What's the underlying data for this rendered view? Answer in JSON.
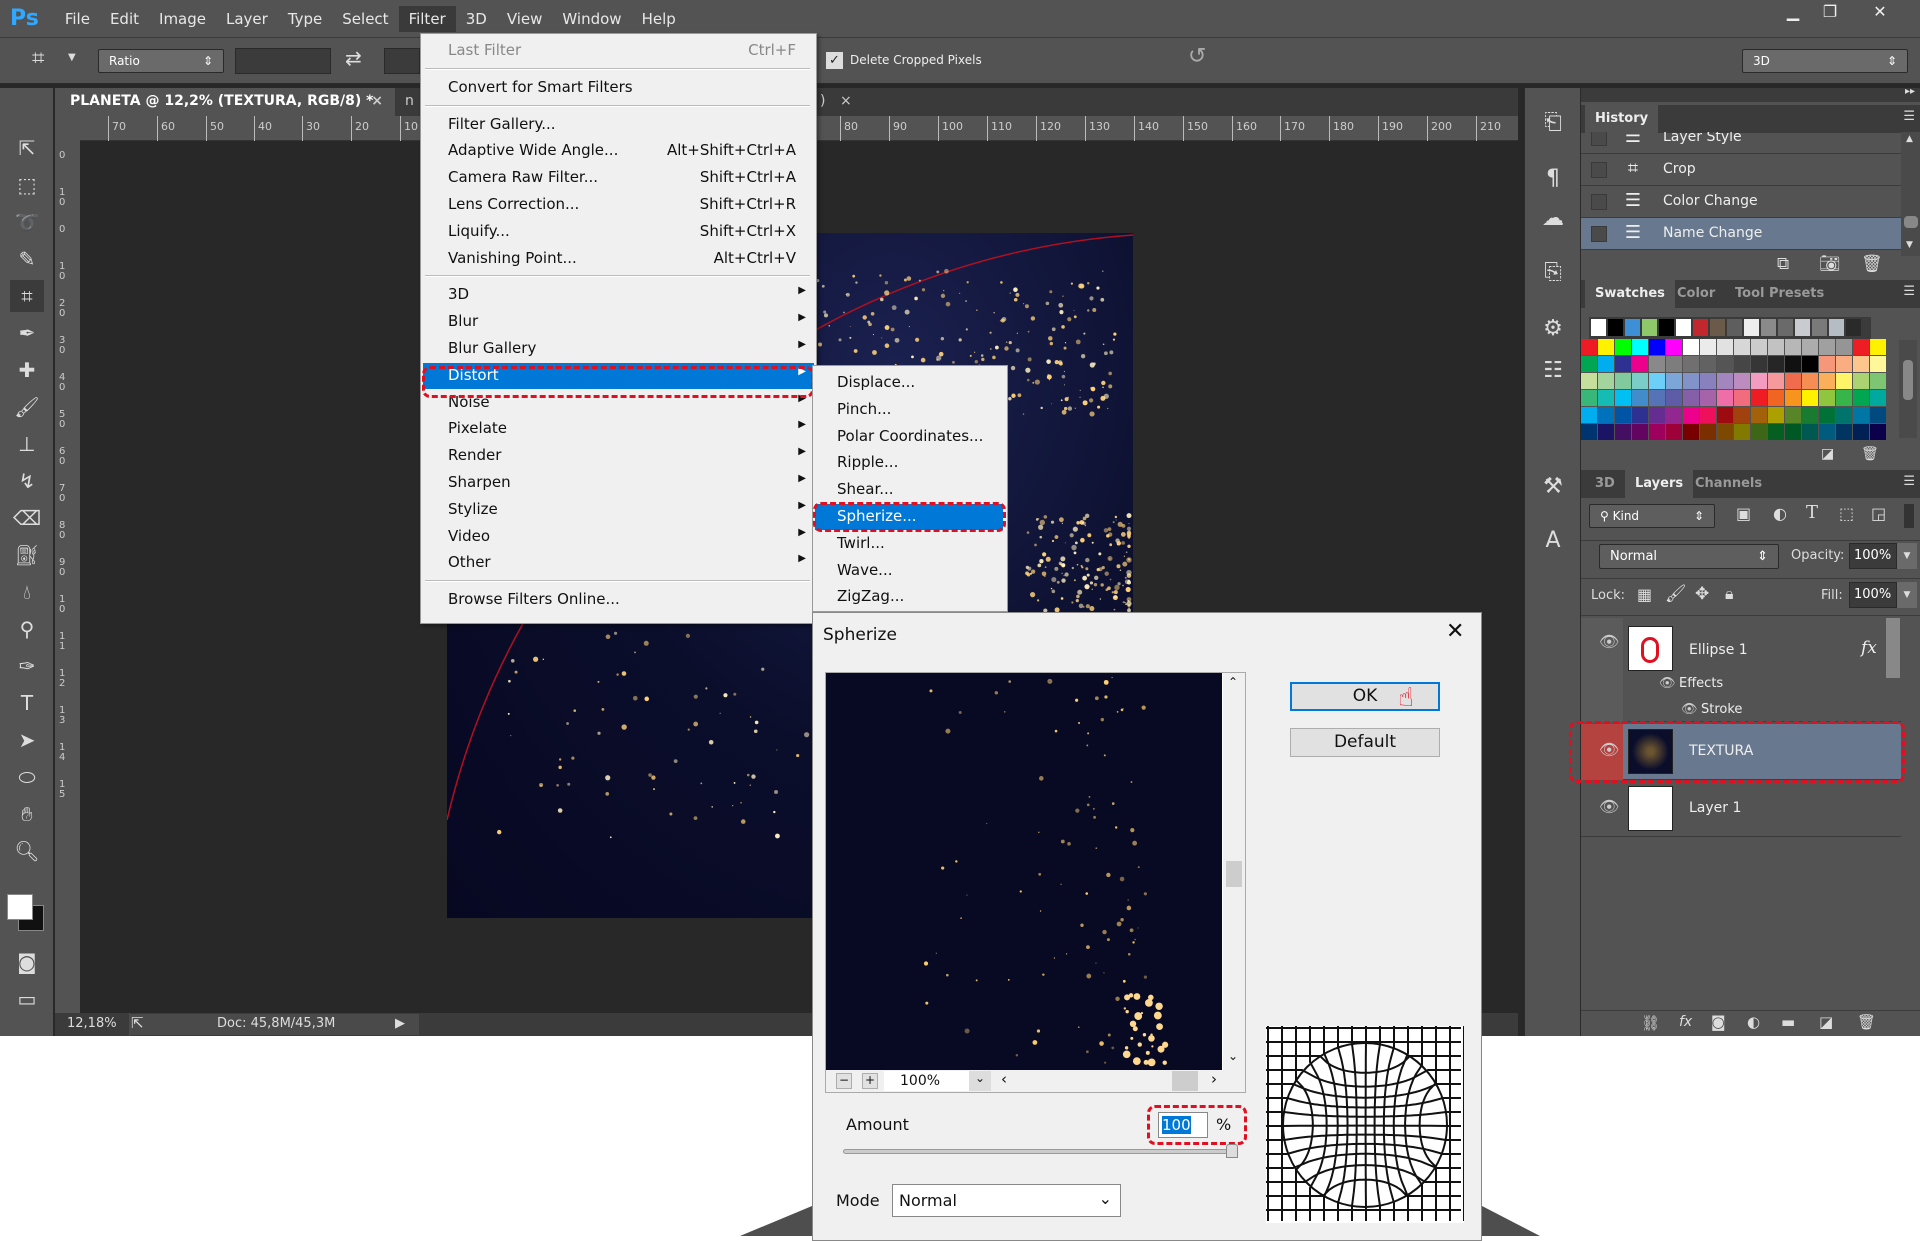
{
  "app": {
    "logo": "Ps",
    "menu": [
      "File",
      "Edit",
      "Image",
      "Layer",
      "Type",
      "Select",
      "Filter",
      "3D",
      "View",
      "Window",
      "Help"
    ],
    "active_menu": "Filter",
    "window_controls": [
      "minimize",
      "restore",
      "close"
    ]
  },
  "options": {
    "ratio": "Ratio",
    "delete_cropped": "Delete Cropped Pixels",
    "delete_cropped_checked": true,
    "workspace": "3D"
  },
  "document": {
    "tab_title": "PLANETA @ 12,2% (TEXTURA, RGB/8) *",
    "tab2_partial": "n",
    "tab2_close_partial": ")",
    "ruler_h": [
      "70",
      "60",
      "50",
      "40",
      "30",
      "20",
      "10",
      "80",
      "90",
      "100",
      "110",
      "120",
      "130",
      "140",
      "150",
      "160",
      "170",
      "180",
      "190",
      "200",
      "210"
    ],
    "ruler_v": [
      "0",
      "1 0",
      "0",
      "1 0",
      "2 0",
      "3 0",
      "4 0",
      "5 0",
      "6 0",
      "7 0",
      "8 0",
      "9 0",
      "1 0",
      "1 1",
      "1 2",
      "1 3",
      "1 4",
      "1 5"
    ],
    "zoom": "12,18%",
    "doc_size": "Doc: 45,8M/45,3M"
  },
  "filter_menu": {
    "items": [
      {
        "label": "Last Filter",
        "shortcut": "Ctrl+F",
        "disabled": true
      },
      {
        "sep": true
      },
      {
        "label": "Convert for Smart Filters"
      },
      {
        "sep": true
      },
      {
        "label": "Filter Gallery..."
      },
      {
        "label": "Adaptive Wide Angle...",
        "shortcut": "Alt+Shift+Ctrl+A"
      },
      {
        "label": "Camera Raw Filter...",
        "shortcut": "Shift+Ctrl+A"
      },
      {
        "label": "Lens Correction...",
        "shortcut": "Shift+Ctrl+R"
      },
      {
        "label": "Liquify...",
        "shortcut": "Shift+Ctrl+X"
      },
      {
        "label": "Vanishing Point...",
        "shortcut": "Alt+Ctrl+V"
      },
      {
        "sep": true
      },
      {
        "label": "3D",
        "sub": true
      },
      {
        "label": "Blur",
        "sub": true
      },
      {
        "label": "Blur Gallery",
        "sub": true
      },
      {
        "label": "Distort",
        "sub": true,
        "highlight": true
      },
      {
        "label": "Noise",
        "sub": true
      },
      {
        "label": "Pixelate",
        "sub": true
      },
      {
        "label": "Render",
        "sub": true
      },
      {
        "label": "Sharpen",
        "sub": true
      },
      {
        "label": "Stylize",
        "sub": true
      },
      {
        "label": "Video",
        "sub": true
      },
      {
        "label": "Other",
        "sub": true
      },
      {
        "sep": true
      },
      {
        "label": "Browse Filters Online..."
      }
    ]
  },
  "distort_submenu": {
    "items": [
      "Displace...",
      "Pinch...",
      "Polar Coordinates...",
      "Ripple...",
      "Shear...",
      "Spherize...",
      "Twirl...",
      "Wave...",
      "ZigZag..."
    ],
    "highlight": "Spherize..."
  },
  "dialog": {
    "title": "Spherize",
    "ok": "OK",
    "default": "Default",
    "preview_zoom": "100%",
    "amount_label": "Amount",
    "amount": "100",
    "amount_unit": "%",
    "amount_value": 100,
    "mode_label": "Mode",
    "mode": "Normal"
  },
  "history": {
    "tab": "History",
    "items": [
      {
        "label": "Layer Style",
        "icon": "document-icon"
      },
      {
        "label": "Crop",
        "icon": "crop-icon"
      },
      {
        "label": "Color Change",
        "icon": "document-icon"
      },
      {
        "label": "Name Change",
        "icon": "document-icon",
        "selected": true
      }
    ]
  },
  "swatches": {
    "tabs": [
      "Swatches",
      "Color",
      "Tool Presets"
    ],
    "recent": [
      "#ffffff",
      "#000000",
      "#3d8fd6",
      "#8fc86a",
      "#000000",
      "#ffffff",
      "#c1272d",
      "#6b5a4a",
      "#5e5e5e",
      "#eeeeee",
      "#8a8a8a",
      "#6a6a6a",
      "#c8ccd0",
      "#7a7a7a",
      "#b5bcc4",
      "#2a2a2a"
    ],
    "grid": [
      [
        "#ed1c24",
        "#fff200",
        "#00ff00",
        "#00ffff",
        "#0000ff",
        "#ff00ff",
        "#ffffff",
        "#ebebeb",
        "#e1e1e1",
        "#d7d7d7",
        "#cccccc",
        "#c2c2c2",
        "#b7b7b7",
        "#acacac",
        "#a0a0a0",
        "#959595",
        "#ee1d24",
        "#fff100"
      ],
      [
        "#00a651",
        "#00aeef",
        "#2e3192",
        "#ec008c",
        "#898989",
        "#7d7d7d",
        "#707070",
        "#626262",
        "#555555",
        "#464646",
        "#363636",
        "#262626",
        "#111111",
        "#000000",
        "#f7977a",
        "#fbad82",
        "#fdc68c",
        "#fff799"
      ],
      [
        "#c6df9c",
        "#a4d49d",
        "#81ca9d",
        "#7bcdc9",
        "#6ccff7",
        "#7ca6d8",
        "#8293ca",
        "#8881be",
        "#a286bd",
        "#bc8cbf",
        "#f49bc1",
        "#f5999d",
        "#f16c4d",
        "#f68e54",
        "#fbaf5a",
        "#fff467",
        "#acd372",
        "#7dc473"
      ],
      [
        "#39b778",
        "#16bcb4",
        "#00bff3",
        "#438ccb",
        "#5573b7",
        "#5e5ca7",
        "#855fa8",
        "#a763a9",
        "#ef6ea8",
        "#f16d7e",
        "#ee1d24",
        "#f16522",
        "#f7941d",
        "#fff100",
        "#8fc63d",
        "#37b44a",
        "#00a650",
        "#00a99e"
      ],
      [
        "#00aeef",
        "#0072bc",
        "#0054a5",
        "#2f3192",
        "#652c91",
        "#91278f",
        "#ed008c",
        "#ee105a",
        "#9d0a0f",
        "#a1410d",
        "#a36209",
        "#aba000",
        "#588528",
        "#197b30",
        "#007236",
        "#00736a",
        "#0076a4",
        "#004a80"
      ],
      [
        "#003471",
        "#1b1464",
        "#440e62",
        "#630460",
        "#9e005d",
        "#9e0039",
        "#790000",
        "#7b2e00",
        "#7d4900",
        "#827a00",
        "#3e6617",
        "#045f20",
        "#005824",
        "#005951",
        "#005b7e",
        "#003562",
        "#002056",
        "#0c004b"
      ]
    ]
  },
  "layers": {
    "tabs": [
      "3D",
      "Layers",
      "Channels"
    ],
    "filter": "Kind",
    "blend_mode": "Normal",
    "opacity_label": "Opacity:",
    "opacity": "100%",
    "lock_label": "Lock:",
    "fill_label": "Fill:",
    "fill": "100%",
    "items": [
      {
        "name": "Ellipse 1",
        "fx": "fx",
        "effects": "Effects",
        "stroke": "Stroke"
      },
      {
        "name": "TEXTURA",
        "selected": true
      },
      {
        "name": "Layer 1"
      }
    ]
  },
  "colors": {
    "highlight": "#0078d7",
    "annotation": "#e01020",
    "panel": "#535353",
    "selected_row": "#68798f"
  }
}
